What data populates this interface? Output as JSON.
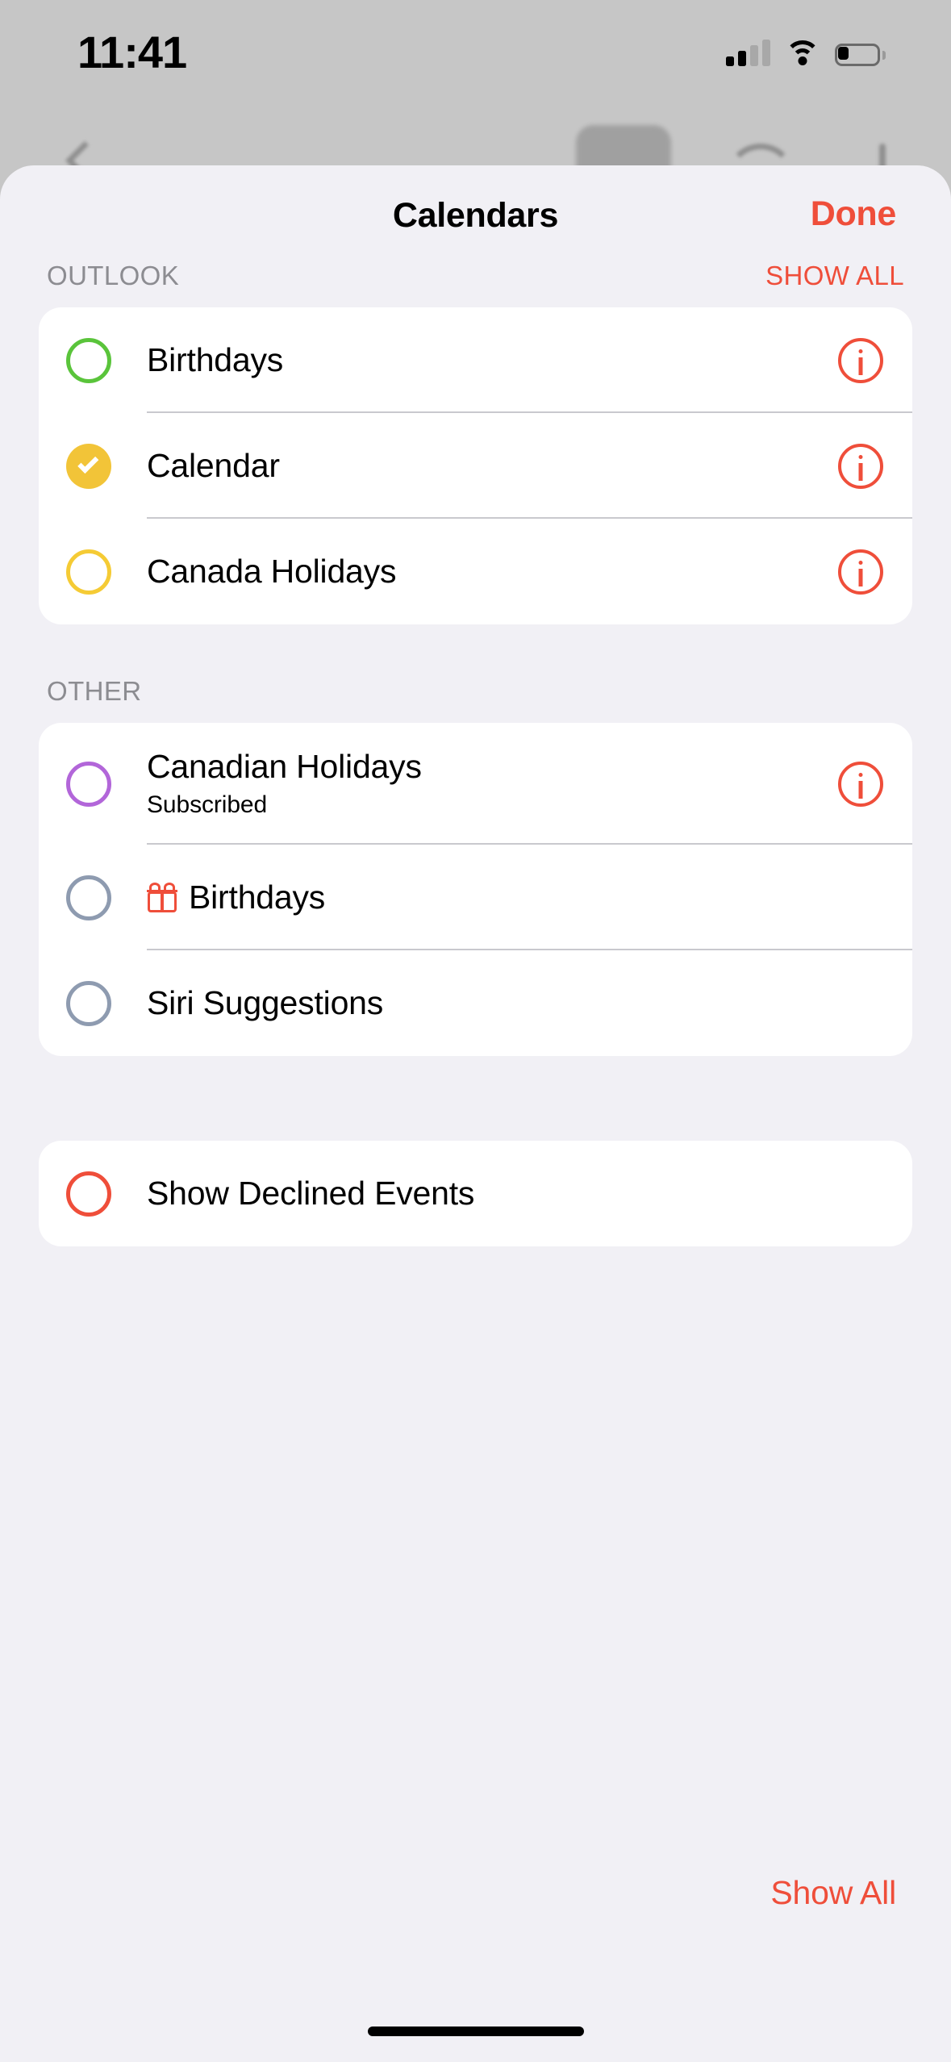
{
  "status_bar": {
    "time": "11:41",
    "cellular_icon": "cellular-bars-icon",
    "wifi_icon": "wifi-icon",
    "battery_icon": "battery-low-icon"
  },
  "sheet": {
    "title": "Calendars",
    "done_label": "Done"
  },
  "sections": [
    {
      "header": "OUTLOOK",
      "action": "SHOW ALL",
      "rows": [
        {
          "title": "Birthdays",
          "subtitle": "",
          "selected": false,
          "color": "#5ac43b",
          "has_info": true,
          "icon": ""
        },
        {
          "title": "Calendar",
          "subtitle": "",
          "selected": true,
          "color": "#f2c438",
          "has_info": true,
          "icon": ""
        },
        {
          "title": "Canada Holidays",
          "subtitle": "",
          "selected": false,
          "color": "#f5cb35",
          "has_info": true,
          "icon": ""
        }
      ]
    },
    {
      "header": "OTHER",
      "action": "",
      "rows": [
        {
          "title": "Canadian Holidays",
          "subtitle": "Subscribed",
          "selected": false,
          "color": "#b266d9",
          "has_info": true,
          "icon": ""
        },
        {
          "title": "Birthdays",
          "subtitle": "",
          "selected": false,
          "color": "#8e9bb0",
          "has_info": false,
          "icon": "gift-icon"
        },
        {
          "title": "Siri Suggestions",
          "subtitle": "",
          "selected": false,
          "color": "#8e9bb0",
          "has_info": false,
          "icon": ""
        }
      ]
    },
    {
      "header": "",
      "action": "",
      "rows": [
        {
          "title": "Show Declined Events",
          "subtitle": "",
          "selected": false,
          "color": "#ef4e3a",
          "has_info": false,
          "icon": ""
        }
      ]
    }
  ],
  "footer": {
    "show_all_label": "Show All"
  },
  "colors": {
    "accent": "#ef4e3a",
    "sheet_bg": "#f1f0f5",
    "card_bg": "#ffffff",
    "backdrop": "#c6c6c6",
    "section_label": "#8c8c91"
  }
}
